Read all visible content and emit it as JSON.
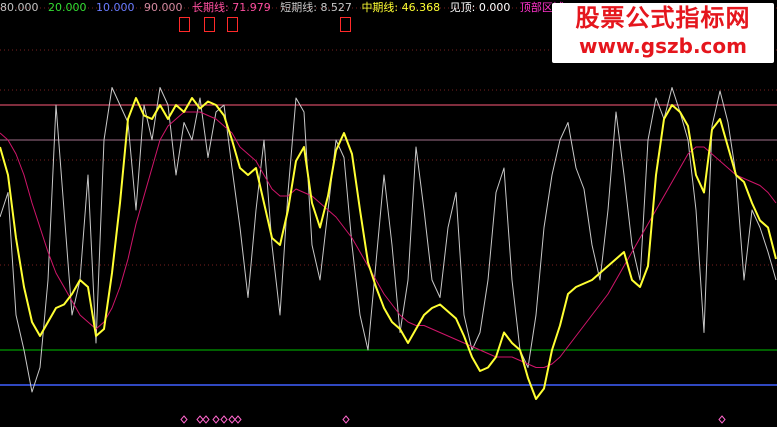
{
  "legend": {
    "v80": "80.000",
    "v20": "20.000",
    "v10": "10.000",
    "v90": "90.000",
    "long_label": "长期线:",
    "long_value": "71.979",
    "short_label": "短期线:",
    "short_value": "8.527",
    "mid_label": "中期线:",
    "mid_value": "46.368",
    "top_label": "见顶:",
    "top_value": "0.000",
    "zone_label": "顶部区域"
  },
  "watermark": {
    "title": "股票公式指标网",
    "url": "www.gszb.com"
  },
  "colors": {
    "short_line": "#c8c8c8",
    "mid_line": "#ffff33",
    "long_line": "#d0156a",
    "level_90": "#ff5a7a",
    "level_80": "#a0708a",
    "level_20": "#00c000",
    "level_10": "#4060ff",
    "marker": "#ff2a2a"
  },
  "chart_data": {
    "type": "line",
    "ylim": [
      0,
      100
    ],
    "levels": [
      {
        "name": "90",
        "value": 90
      },
      {
        "name": "80",
        "value": 80
      },
      {
        "name": "20",
        "value": 20
      },
      {
        "name": "10",
        "value": 10
      }
    ],
    "x": [
      0,
      8,
      16,
      24,
      32,
      40,
      48,
      56,
      64,
      72,
      80,
      88,
      96,
      104,
      112,
      120,
      128,
      136,
      144,
      152,
      160,
      168,
      176,
      184,
      192,
      200,
      208,
      216,
      224,
      232,
      240,
      248,
      256,
      264,
      272,
      280,
      288,
      296,
      304,
      312,
      320,
      328,
      336,
      344,
      352,
      360,
      368,
      376,
      384,
      392,
      400,
      408,
      416,
      424,
      432,
      440,
      448,
      456,
      464,
      472,
      480,
      488,
      496,
      504,
      512,
      520,
      528,
      536,
      544,
      552,
      560,
      568,
      576,
      584,
      592,
      600,
      608,
      616,
      624,
      632,
      640,
      648,
      656,
      664,
      672,
      680,
      688,
      696,
      704,
      712,
      720,
      728,
      736,
      744,
      752,
      760,
      768,
      776
    ],
    "series": [
      {
        "name": "中期线",
        "values": [
          78,
          70,
          52,
          38,
          28,
          24,
          28,
          32,
          33,
          36,
          40,
          38,
          24,
          26,
          42,
          62,
          86,
          92,
          87,
          86,
          90,
          86,
          90,
          88,
          92,
          89,
          91,
          90,
          87,
          80,
          72,
          70,
          72,
          62,
          52,
          50,
          60,
          74,
          78,
          62,
          55,
          64,
          77,
          82,
          76,
          60,
          45,
          38,
          32,
          28,
          26,
          22,
          26,
          30,
          32,
          33,
          31,
          29,
          24,
          18,
          14,
          15,
          18,
          25,
          22,
          20,
          12,
          6,
          9,
          20,
          27,
          36,
          38,
          39,
          40,
          42,
          44,
          46,
          48,
          40,
          38,
          44,
          70,
          86,
          90,
          88,
          84,
          70,
          65,
          83,
          86,
          78,
          70,
          68,
          62,
          57,
          55,
          46
        ]
      },
      {
        "name": "长期线",
        "values": [
          82,
          80,
          76,
          70,
          62,
          55,
          48,
          42,
          38,
          34,
          30,
          28,
          26,
          28,
          32,
          38,
          46,
          56,
          64,
          72,
          80,
          84,
          86,
          88,
          88,
          88,
          87,
          86,
          84,
          82,
          78,
          76,
          74,
          70,
          66,
          64,
          64,
          66,
          65,
          64,
          62,
          60,
          58,
          55,
          52,
          48,
          44,
          40,
          36,
          33,
          30,
          28,
          27,
          27,
          26,
          25,
          24,
          23,
          22,
          21,
          20,
          19,
          18,
          18,
          18,
          17,
          16,
          15,
          15,
          16,
          18,
          21,
          24,
          27,
          30,
          33,
          36,
          40,
          44,
          48,
          52,
          56,
          60,
          64,
          68,
          72,
          76,
          78,
          78,
          76,
          74,
          72,
          70,
          69,
          68,
          67,
          65,
          62
        ]
      },
      {
        "name": "短期线",
        "values": [
          58,
          65,
          30,
          20,
          8,
          15,
          40,
          90,
          60,
          30,
          40,
          70,
          22,
          80,
          95,
          90,
          85,
          60,
          90,
          80,
          95,
          90,
          70,
          85,
          80,
          92,
          75,
          88,
          90,
          72,
          55,
          35,
          60,
          80,
          50,
          30,
          65,
          92,
          88,
          50,
          40,
          60,
          80,
          75,
          50,
          30,
          20,
          45,
          70,
          50,
          25,
          40,
          78,
          60,
          40,
          35,
          55,
          65,
          30,
          20,
          25,
          40,
          65,
          72,
          40,
          20,
          15,
          30,
          55,
          70,
          80,
          85,
          72,
          66,
          50,
          40,
          60,
          88,
          70,
          50,
          40,
          80,
          92,
          86,
          95,
          88,
          80,
          60,
          25,
          84,
          94,
          85,
          70,
          40,
          60,
          55,
          48,
          40
        ]
      }
    ],
    "top_markers_x": [
      184,
      210,
      232,
      346
    ],
    "bottom_markers_x": [
      184,
      200,
      206,
      216,
      224,
      232,
      238,
      346,
      722
    ]
  }
}
